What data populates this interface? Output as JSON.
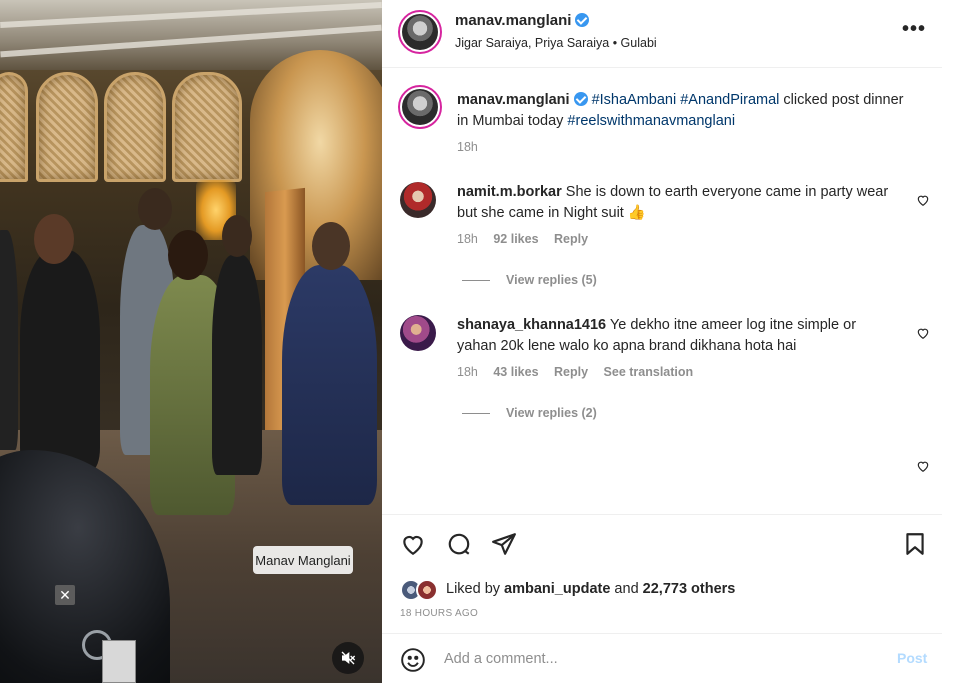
{
  "media": {
    "watermark": "Manav Manglani",
    "close_label": "✕",
    "mute_icon": "speaker-muted-icon"
  },
  "header": {
    "username": "manav.manglani",
    "verified": true,
    "subtitle": "Jigar Saraiya, Priya Saraiya • Gulabi",
    "more_label": "•••"
  },
  "caption": {
    "username": "manav.manglani",
    "tags_1": "#IshaAmbani #AnandPiramal",
    "text_1": " clicked post dinner in Mumbai today ",
    "tags_2": "#reelswithmanavmanglani",
    "time": "18h"
  },
  "comments": [
    {
      "username": "namit.m.borkar",
      "text": "She is down to earth everyone came in party wear but she came in Night suit 👍",
      "time": "18h",
      "likes": "92 likes",
      "reply": "Reply",
      "view_replies": "View replies (5)"
    },
    {
      "username": "shanaya_khanna1416",
      "text": "Ye dekho itne ameer log itne simple or yahan 20k lene walo ko apna brand dikhana hota hai",
      "time": "18h",
      "likes": "43 likes",
      "reply": "Reply",
      "translate": "See translation",
      "view_replies": "View replies (2)"
    }
  ],
  "actions": {
    "liked_prefix": "Liked by ",
    "liked_user": "ambani_update",
    "liked_mid": " and ",
    "liked_count": "22,773 others",
    "time_ago": "18 HOURS AGO"
  },
  "add_comment": {
    "placeholder": "Add a comment...",
    "post_label": "Post"
  },
  "colors": {
    "link": "#00376b",
    "verified": "#3897f0",
    "muted": "#8e8e8e",
    "post_disabled": "#b3dbff"
  }
}
